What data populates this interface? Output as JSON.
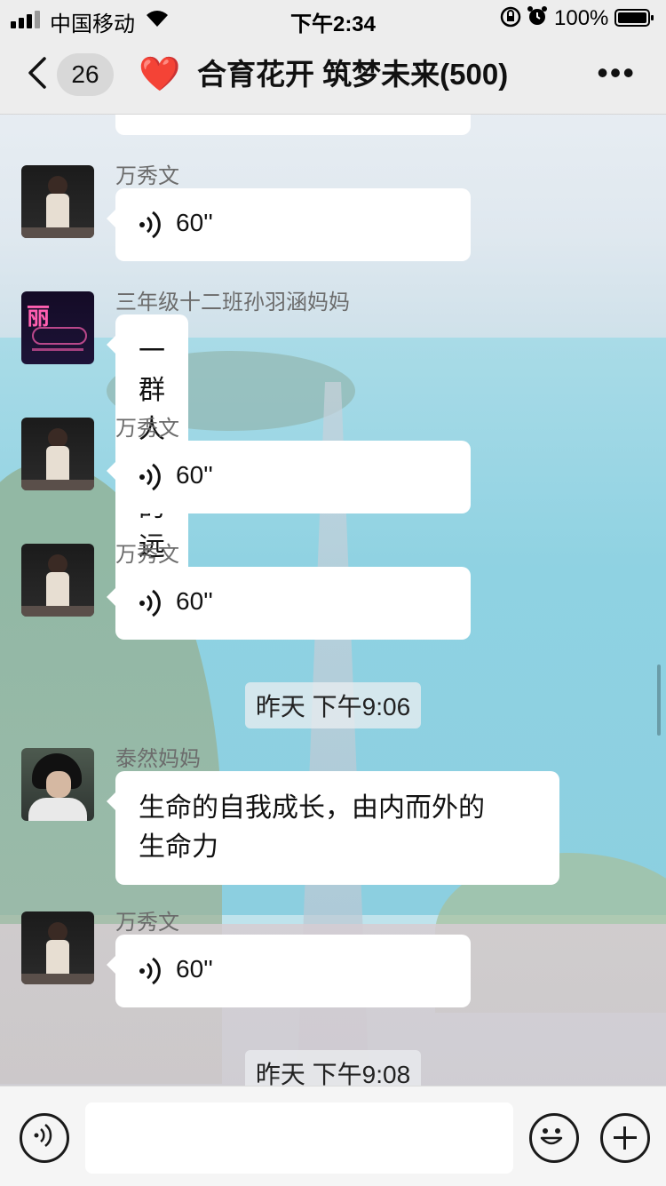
{
  "status_bar": {
    "carrier": "中国移动",
    "time": "下午2:34",
    "battery": "100%"
  },
  "nav": {
    "unread_count": "26",
    "title_emoji": "❤️",
    "title": "合育花开 筑梦未来(500)",
    "more": "•••"
  },
  "messages": [
    {
      "sender": "万秀文",
      "type": "voice",
      "duration": "60''"
    },
    {
      "sender": "三年级十二班孙羽涵妈妈",
      "type": "text",
      "text": "一群人走的远"
    },
    {
      "sender": "万秀文",
      "type": "voice",
      "duration": "60''"
    },
    {
      "sender": "万秀文",
      "type": "voice",
      "duration": "60''"
    },
    {
      "type": "timestamp",
      "text": "昨天 下午9:06"
    },
    {
      "sender": "泰然妈妈",
      "type": "text",
      "text_line1": "生命的自我成长，由内而外的",
      "text_line2": "生命力"
    },
    {
      "sender": "万秀文",
      "type": "voice",
      "duration": "60''"
    },
    {
      "type": "timestamp",
      "text": "昨天 下午9:08"
    }
  ],
  "avatar_text": {
    "sun_mom": "丽"
  },
  "icons": {
    "back": "chevron-left-icon",
    "heart": "heart-icon",
    "more": "more-dots-icon",
    "voice_input": "voice-input-icon",
    "emoji": "emoji-icon",
    "plus": "plus-icon"
  },
  "colors": {
    "bar_bg": "#ededed",
    "bubble": "#ffffff",
    "heart": "#e0202c"
  }
}
